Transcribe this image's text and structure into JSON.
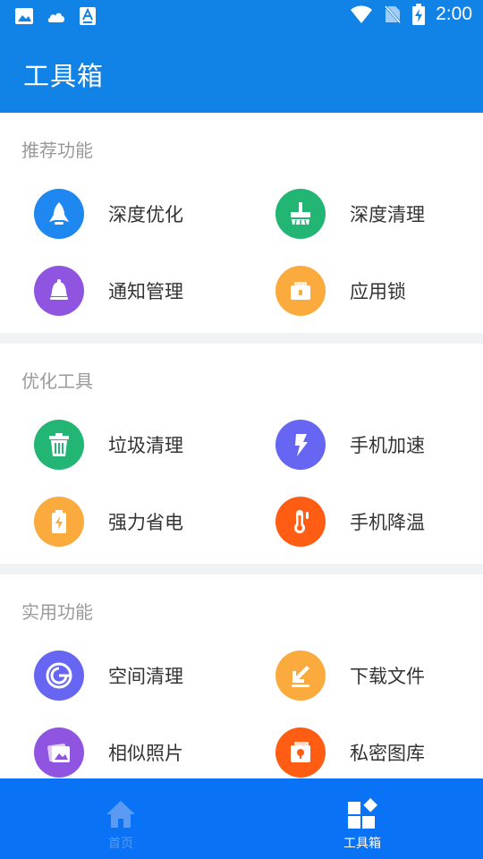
{
  "status_bar": {
    "time": "2:00",
    "left_icons": [
      "image-icon",
      "cloud-icon",
      "font-icon"
    ],
    "right_icons": [
      "wifi-icon",
      "no-sim-icon",
      "battery-charging-icon"
    ]
  },
  "header": {
    "title": "工具箱"
  },
  "colors": {
    "header_bg": "#1283e6",
    "nav_bg": "#0a73f5",
    "blue": "#1e88f0",
    "green": "#22b573",
    "purple": "#8f55e0",
    "orange": "#fbaa3e",
    "violet": "#6766f2",
    "deep_orange": "#ff5c14"
  },
  "sections": [
    {
      "title": "推荐功能",
      "items": [
        {
          "label": "深度优化",
          "icon": "rocket-icon",
          "color": "#1e88f0"
        },
        {
          "label": "深度清理",
          "icon": "broom-icon",
          "color": "#22b573"
        },
        {
          "label": "通知管理",
          "icon": "bell-icon",
          "color": "#8f55e0"
        },
        {
          "label": "应用锁",
          "icon": "lock-box-icon",
          "color": "#fbaa3e"
        }
      ]
    },
    {
      "title": "优化工具",
      "items": [
        {
          "label": "垃圾清理",
          "icon": "trash-icon",
          "color": "#22b573"
        },
        {
          "label": "手机加速",
          "icon": "lightning-icon",
          "color": "#6766f2"
        },
        {
          "label": "强力省电",
          "icon": "battery-icon",
          "color": "#fbaa3e"
        },
        {
          "label": "手机降温",
          "icon": "thermometer-icon",
          "color": "#ff5c14"
        }
      ]
    },
    {
      "title": "实用功能",
      "items": [
        {
          "label": "空间清理",
          "icon": "storage-ring-icon",
          "color": "#6766f2"
        },
        {
          "label": "下载文件",
          "icon": "download-arrow-icon",
          "color": "#fbaa3e"
        },
        {
          "label": "相似照片",
          "icon": "photos-icon",
          "color": "#8f55e0"
        },
        {
          "label": "私密图库",
          "icon": "private-gallery-icon",
          "color": "#ff5c14"
        }
      ]
    }
  ],
  "bottom_nav": [
    {
      "label": "首页",
      "icon": "home-icon",
      "active": false
    },
    {
      "label": "工具箱",
      "icon": "toolbox-grid-icon",
      "active": true
    }
  ]
}
